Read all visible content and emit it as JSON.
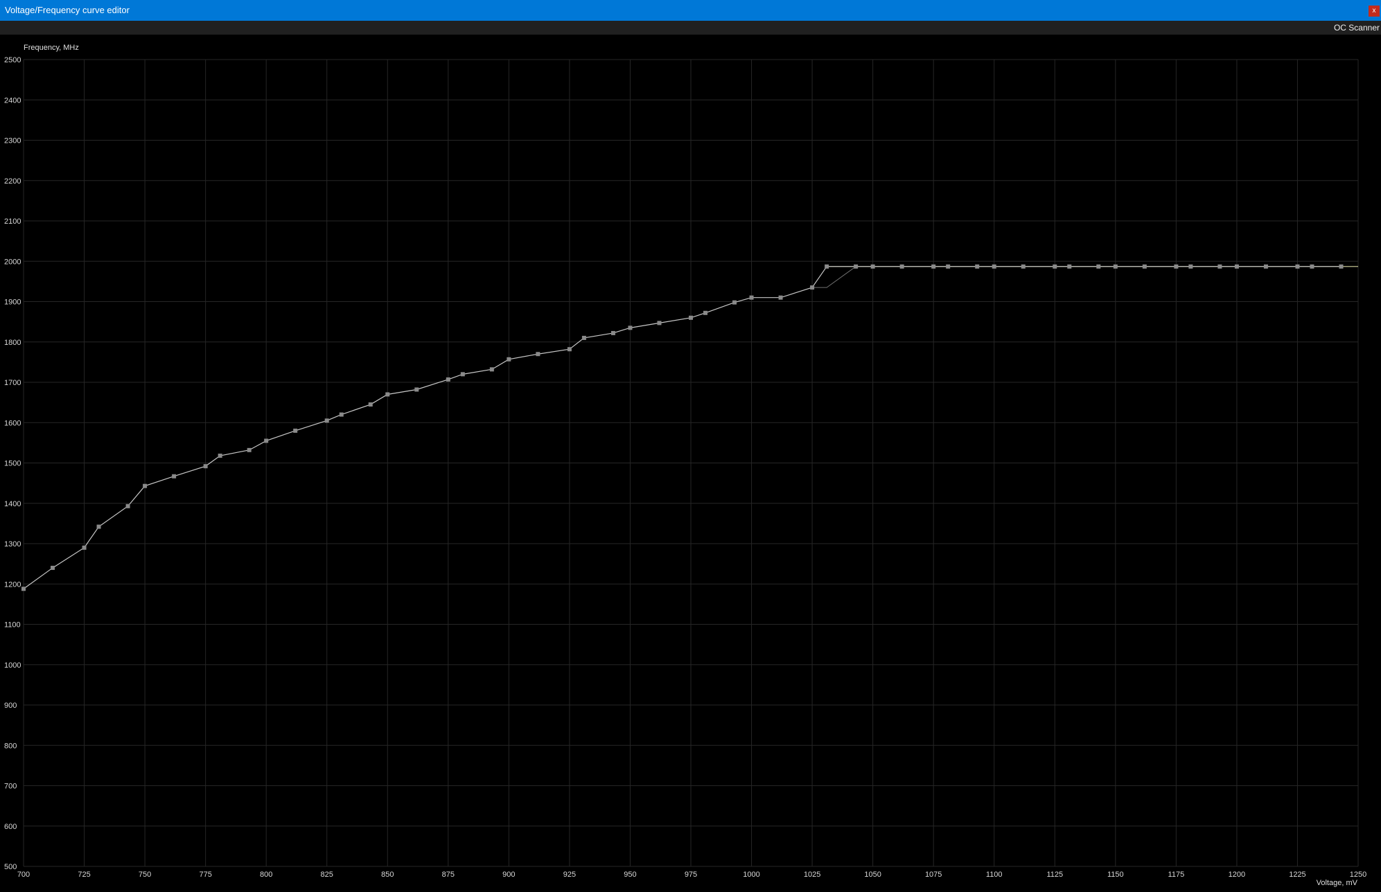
{
  "window": {
    "title": "Voltage/Frequency curve editor",
    "close_label": "x",
    "accent": "#0078d7"
  },
  "toolbar": {
    "oc_scanner_label": "OC Scanner"
  },
  "chart_data": {
    "type": "line",
    "ylabel": "Frequency, MHz",
    "xlabel": "Voltage, mV",
    "xlim": [
      700,
      1250
    ],
    "ylim": [
      500,
      2500
    ],
    "grid": true,
    "xticks": [
      700,
      725,
      750,
      775,
      800,
      825,
      850,
      875,
      900,
      925,
      950,
      975,
      1000,
      1025,
      1050,
      1075,
      1100,
      1125,
      1150,
      1175,
      1200,
      1225,
      1250
    ],
    "yticks": [
      500,
      600,
      700,
      800,
      900,
      1000,
      1100,
      1200,
      1300,
      1400,
      1500,
      1600,
      1700,
      1800,
      1900,
      2000,
      2100,
      2200,
      2300,
      2400,
      2500
    ],
    "colors": {
      "curve": "#c8c8c8",
      "point": "#8a8a8a",
      "baseline": "#707070",
      "flat": "#d6d6a0",
      "grid": "#262626"
    },
    "series": [
      {
        "role": "curve",
        "points": [
          [
            700,
            1188
          ],
          [
            712,
            1240
          ],
          [
            725,
            1290
          ],
          [
            731,
            1342
          ],
          [
            743,
            1393
          ],
          [
            750,
            1443
          ],
          [
            762,
            1467
          ],
          [
            775,
            1492
          ],
          [
            781,
            1518
          ],
          [
            793,
            1532
          ],
          [
            800,
            1555
          ],
          [
            812,
            1580
          ],
          [
            825,
            1605
          ],
          [
            831,
            1620
          ],
          [
            843,
            1645
          ],
          [
            850,
            1670
          ],
          [
            862,
            1682
          ],
          [
            875,
            1707
          ],
          [
            881,
            1720
          ],
          [
            893,
            1732
          ],
          [
            900,
            1757
          ],
          [
            912,
            1770
          ],
          [
            925,
            1782
          ],
          [
            931,
            1810
          ],
          [
            943,
            1822
          ],
          [
            950,
            1835
          ],
          [
            962,
            1847
          ],
          [
            975,
            1860
          ],
          [
            981,
            1872
          ],
          [
            993,
            1898
          ],
          [
            1000,
            1910
          ],
          [
            1012,
            1910
          ],
          [
            1025,
            1935
          ],
          [
            1031,
            1987
          ],
          [
            1043,
            1987
          ],
          [
            1050,
            1987
          ],
          [
            1062,
            1987
          ],
          [
            1075,
            1987
          ],
          [
            1081,
            1987
          ],
          [
            1093,
            1987
          ],
          [
            1100,
            1987
          ],
          [
            1112,
            1987
          ],
          [
            1125,
            1987
          ],
          [
            1131,
            1987
          ],
          [
            1143,
            1987
          ],
          [
            1150,
            1987
          ],
          [
            1162,
            1987
          ],
          [
            1175,
            1987
          ],
          [
            1181,
            1987
          ],
          [
            1193,
            1987
          ],
          [
            1200,
            1987
          ],
          [
            1212,
            1987
          ],
          [
            1225,
            1987
          ],
          [
            1231,
            1987
          ],
          [
            1243,
            1987
          ]
        ]
      },
      {
        "role": "baseline",
        "points": [
          [
            1025,
            1935
          ],
          [
            1031,
            1935
          ],
          [
            1043,
            1987
          ]
        ]
      },
      {
        "role": "flat",
        "points": [
          [
            1031,
            1987
          ],
          [
            1250,
            1987
          ]
        ]
      }
    ]
  }
}
